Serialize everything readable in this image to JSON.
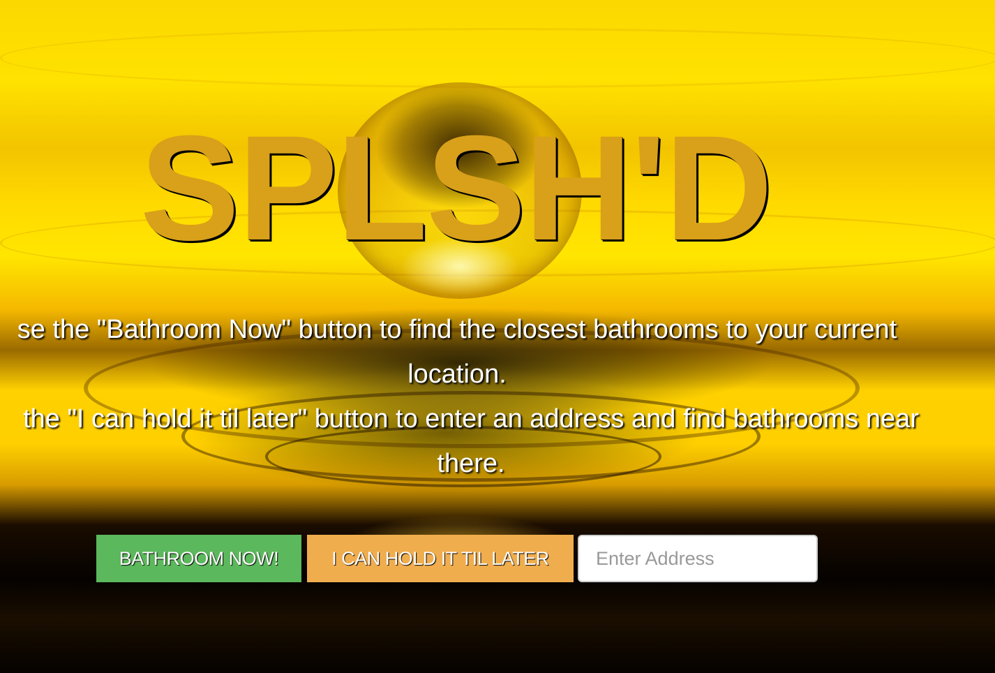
{
  "hero": {
    "title": "SPLSH'D",
    "instruction_now": "se the \"Bathroom Now\" button to find the closest bathrooms to your current location.",
    "instruction_later": "the \"I can hold it til later\" button to enter an address and find bathrooms near there."
  },
  "actions": {
    "now_label": "BATHROOM NOW!",
    "later_label": "I CAN HOLD IT TIL LATER",
    "address_placeholder": "Enter Address",
    "address_value": ""
  },
  "colors": {
    "title": "#d9a01a",
    "now_button": "#5cb85c",
    "later_button": "#f0ad4e"
  }
}
